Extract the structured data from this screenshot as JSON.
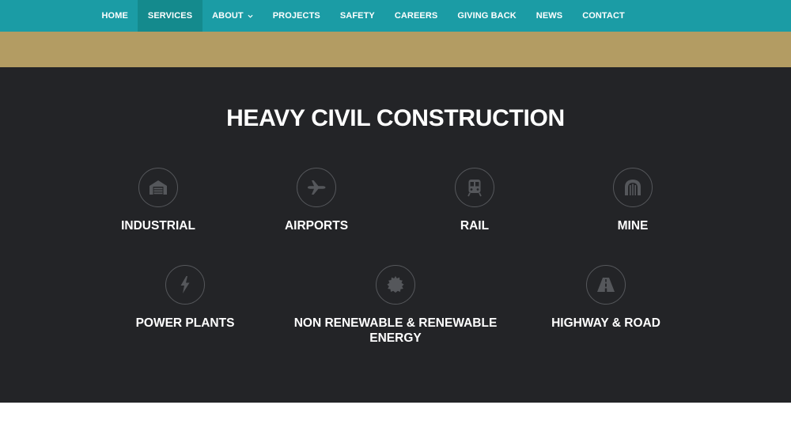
{
  "nav": {
    "items": [
      {
        "label": "HOME"
      },
      {
        "label": "SERVICES"
      },
      {
        "label": "ABOUT"
      },
      {
        "label": "PROJECTS"
      },
      {
        "label": "SAFETY"
      },
      {
        "label": "CAREERS"
      },
      {
        "label": "GIVING BACK"
      },
      {
        "label": "NEWS"
      },
      {
        "label": "CONTACT"
      }
    ]
  },
  "hero": {
    "title": "HEAVY CIVIL CONSTRUCTION"
  },
  "services": [
    {
      "label": "INDUSTRIAL",
      "icon": "warehouse-icon"
    },
    {
      "label": "AIRPORTS",
      "icon": "airplane-icon"
    },
    {
      "label": "RAIL",
      "icon": "train-icon"
    },
    {
      "label": "MINE",
      "icon": "mine-tunnel-icon"
    },
    {
      "label": "POWER PLANTS",
      "icon": "lightning-icon"
    },
    {
      "label": "NON RENEWABLE & RENEWABLE ENERGY",
      "icon": "sun-badge-icon"
    },
    {
      "label": "HIGHWAY & ROAD",
      "icon": "road-icon"
    }
  ],
  "colors": {
    "nav_bg": "#1b9ca5",
    "nav_active": "#148a8d",
    "gold": "#b39c63",
    "hero_bg": "#232427",
    "icon_gray": "#55575b"
  }
}
